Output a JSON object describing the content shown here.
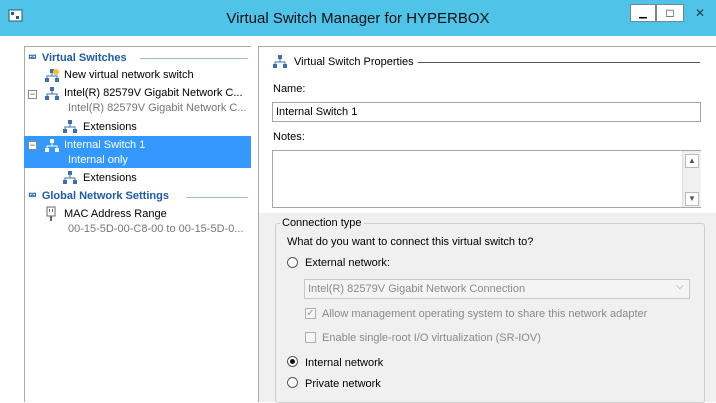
{
  "window": {
    "title": "Virtual Switch Manager for HYPERBOX",
    "minimize_glyph": "▁",
    "maximize_glyph": "□",
    "close_glyph": "✕"
  },
  "left": {
    "virtual_switches_header": "Virtual Switches",
    "items": [
      {
        "label": "New virtual network switch",
        "sub": ""
      },
      {
        "label": "Intel(R) 82579V Gigabit Network C...",
        "sub": "Intel(R) 82579V Gigabit Network C..."
      },
      {
        "label": "Extensions",
        "sub": ""
      },
      {
        "label": "Internal Switch 1",
        "sub": "Internal only"
      },
      {
        "label": "Extensions",
        "sub": ""
      }
    ],
    "global_header": "Global Network Settings",
    "mac": {
      "label": "MAC Address Range",
      "sub": "00-15-5D-00-C8-00 to 00-15-5D-0..."
    }
  },
  "right": {
    "section_title": "Virtual Switch Properties",
    "name_label": "Name:",
    "name_value": "Internal Switch 1",
    "notes_label": "Notes:",
    "notes_value": "",
    "connection_type_label": "Connection type",
    "question": "What do you want to connect this virtual switch to?",
    "external_label": "External network:",
    "adapter_selected": "Intel(R) 82579V Gigabit Network Connection",
    "allow_mgmt_label": "Allow management operating system to share this network adapter",
    "sriov_label": "Enable single-root I/O virtualization (SR-IOV)",
    "internal_label": "Internal network",
    "private_label": "Private network",
    "selected_connection": "internal"
  },
  "colors": {
    "titlebar": "#4fc3e8",
    "selection": "#3399ff",
    "section_header": "#1e5aa8"
  }
}
